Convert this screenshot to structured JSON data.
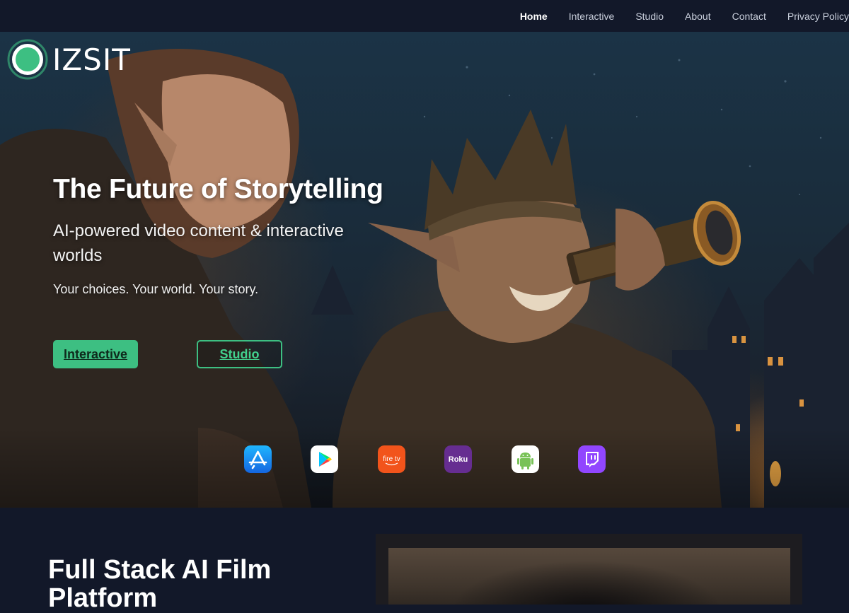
{
  "nav": {
    "items": [
      {
        "label": "Home",
        "active": true
      },
      {
        "label": "Interactive",
        "active": false
      },
      {
        "label": "Studio",
        "active": false
      },
      {
        "label": "About",
        "active": false
      },
      {
        "label": "Contact",
        "active": false
      },
      {
        "label": "Privacy Policy",
        "active": false
      }
    ]
  },
  "brand": {
    "name": "IZSIT",
    "accent": "#3dbf82"
  },
  "hero": {
    "title": "The Future of Storytelling",
    "subtitle": "AI-powered video content & interactive worlds",
    "tagline": "Your choices. Your world. Your story.",
    "primary_button": "Interactive",
    "secondary_button": "Studio"
  },
  "platforms": [
    {
      "icon": "app-store-icon"
    },
    {
      "icon": "google-play-icon"
    },
    {
      "icon": "fire-tv-icon",
      "label": "fire tv"
    },
    {
      "icon": "roku-icon",
      "label": "Roku"
    },
    {
      "icon": "android-icon"
    },
    {
      "icon": "twitch-icon"
    }
  ],
  "section2": {
    "title": "Full Stack AI Film Platform"
  },
  "colors": {
    "background": "#121829",
    "accent": "#3dbf82"
  }
}
